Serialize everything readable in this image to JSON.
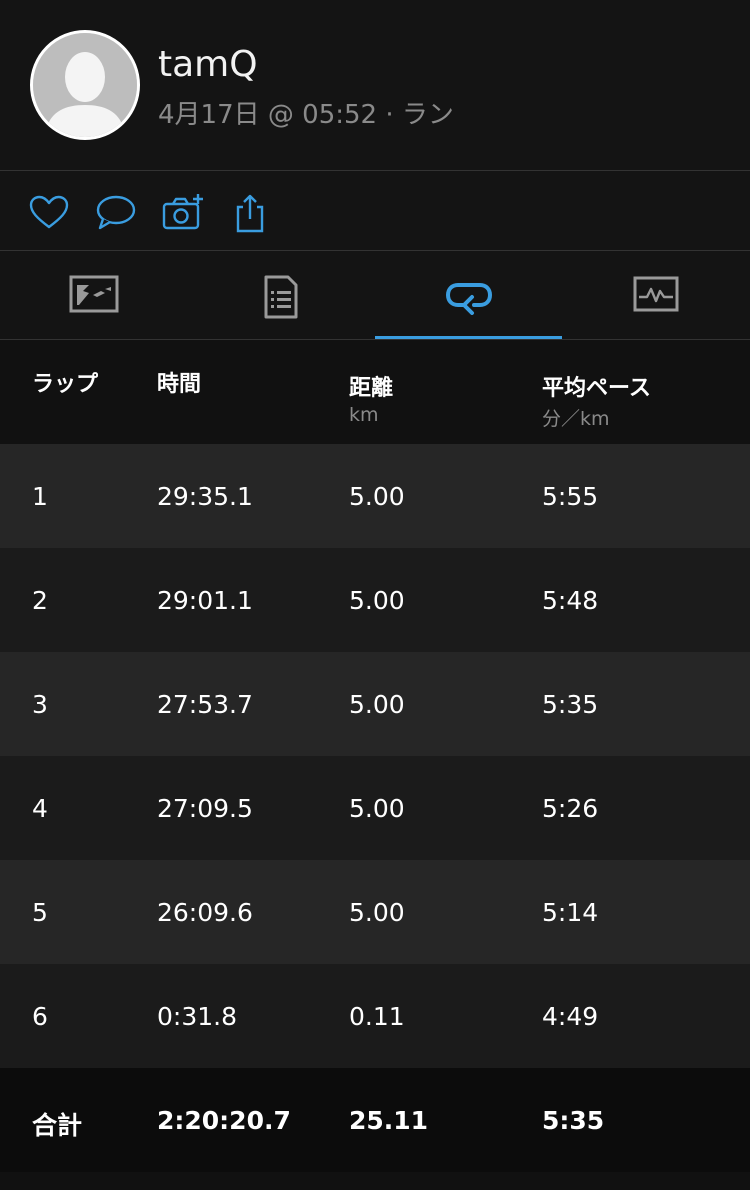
{
  "header": {
    "user_name": "tamQ",
    "meta": "4月17日 @ 05:52 · ラン"
  },
  "actions": [
    {
      "icon": "heart-icon"
    },
    {
      "icon": "comment-icon"
    },
    {
      "icon": "add-photo-icon"
    },
    {
      "icon": "share-icon"
    }
  ],
  "tabs": [
    {
      "icon": "map-icon",
      "active": false
    },
    {
      "icon": "details-icon",
      "active": false
    },
    {
      "icon": "laps-icon",
      "active": true
    },
    {
      "icon": "chart-icon",
      "active": false
    }
  ],
  "colors": {
    "accent": "#3a9de0",
    "icon_inactive": "#9a9a9a",
    "row_odd": "#262626",
    "row_even": "#1b1b1b"
  },
  "table": {
    "headers": {
      "lap": "ラップ",
      "time": "時間",
      "distance": "距離",
      "distance_unit": "km",
      "pace": "平均ペース",
      "pace_unit": "分／km"
    },
    "rows": [
      {
        "lap": "1",
        "time": "29:35.1",
        "distance": "5.00",
        "pace": "5:55"
      },
      {
        "lap": "2",
        "time": "29:01.1",
        "distance": "5.00",
        "pace": "5:48"
      },
      {
        "lap": "3",
        "time": "27:53.7",
        "distance": "5.00",
        "pace": "5:35"
      },
      {
        "lap": "4",
        "time": "27:09.5",
        "distance": "5.00",
        "pace": "5:26"
      },
      {
        "lap": "5",
        "time": "26:09.6",
        "distance": "5.00",
        "pace": "5:14"
      },
      {
        "lap": "6",
        "time": "0:31.8",
        "distance": "0.11",
        "pace": "4:49"
      }
    ],
    "total": {
      "label": "合計",
      "time": "2:20:20.7",
      "distance": "25.11",
      "pace": "5:35"
    }
  }
}
